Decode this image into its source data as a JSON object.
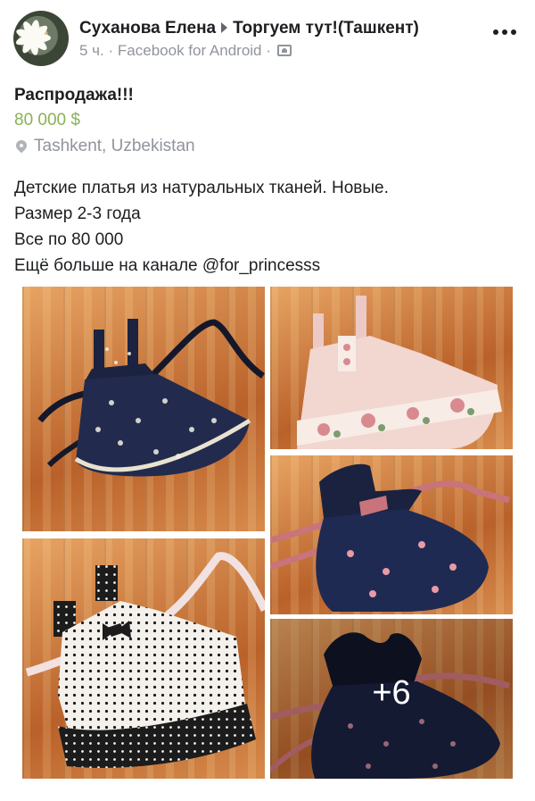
{
  "post": {
    "author": "Суханова Елена",
    "group": "Торгуем тут!(Ташкент)",
    "time": "5 ч.",
    "source": "Facebook for Android",
    "separator": "·"
  },
  "listing": {
    "title": "Распродажа!!!",
    "price": "80 000 $",
    "location": "Tashkent, Uzbekistan"
  },
  "description": [
    "Детские платья из натуральных тканей. Новые.",
    "Размер 2-3 года",
    "Все по 80 000",
    "Ещё больше на канале @for_princesss"
  ],
  "photos": {
    "more_count": "+6"
  },
  "icons": {
    "avatar": "profile-photo-daisy",
    "group_arrow": "triangle-right-icon",
    "audience": "group-audience-icon",
    "more": "more-options-icon",
    "location": "map-pin-icon"
  },
  "colors": {
    "price": "#8ab253",
    "meta": "#90949c",
    "text": "#1c1e21"
  }
}
